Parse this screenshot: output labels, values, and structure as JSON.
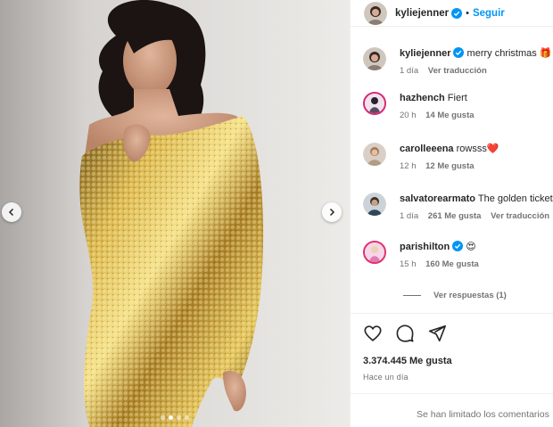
{
  "post": {
    "author": "kyliejenner",
    "follow_label": "Seguir",
    "separator": "•",
    "carousel_dots": 4,
    "active_dot": 1
  },
  "caption": {
    "username": "kyliejenner",
    "text": "merry christmas 🎁",
    "time": "1 día",
    "translate": "Ver traducción"
  },
  "comments": [
    {
      "username": "hazhench",
      "text": "Fiert",
      "time": "20 h",
      "likes": "14 Me gusta",
      "verified": false,
      "story_ring": true
    },
    {
      "username": "carolleeena",
      "text": "rowsss❤️",
      "time": "12 h",
      "likes": "12 Me gusta",
      "verified": false,
      "story_ring": false
    },
    {
      "username": "salvatorearmato",
      "text": "The golden ticket",
      "time": "1 día",
      "likes": "261 Me gusta",
      "translate": "Ver traducción",
      "verified": false,
      "story_ring": false
    },
    {
      "username": "parishilton",
      "text": "😍",
      "time": "15 h",
      "likes": "160 Me gusta",
      "verified": true,
      "story_ring": true
    }
  ],
  "replies_label": "Ver respuestas (1)",
  "stats": {
    "likes": "3.374.445 Me gusta",
    "posted": "Hace un día"
  },
  "footer_notice": "Se han limitado los comentarios",
  "colors": {
    "accent": "#0095f6",
    "verified": "#0095f6",
    "muted": "#737373",
    "gold": "#c9a23a"
  }
}
